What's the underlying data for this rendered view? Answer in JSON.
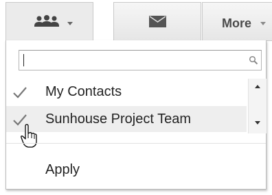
{
  "toolbar": {
    "contacts_button": {
      "icon": "people-icon",
      "has_dropdown": true
    },
    "mail_button": {
      "icon": "envelope-icon"
    },
    "more_label": "More",
    "colors": {
      "button_bg": "#ebebeb",
      "border": "#c9c9c9",
      "icon": "#444444"
    }
  },
  "search": {
    "placeholder": "",
    "value": "",
    "icon": "magnifier-icon"
  },
  "contact_groups": [
    {
      "label": "My Contacts",
      "checked": true
    },
    {
      "label": "Sunhouse Project Team",
      "checked": true,
      "highlighted": true
    }
  ],
  "apply_label": "Apply"
}
